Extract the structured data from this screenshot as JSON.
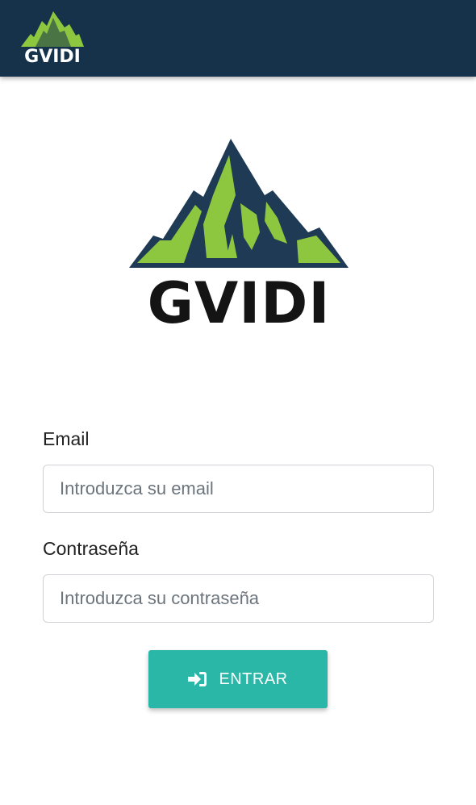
{
  "header": {
    "logo_text": "GVIDI"
  },
  "hero": {
    "logo_text": "GVIDI"
  },
  "login_form": {
    "email_label": "Email",
    "email_placeholder": "Introduzca su email",
    "email_value": "",
    "password_label": "Contraseña",
    "password_placeholder": "Introduzca su contraseña",
    "password_value": "",
    "submit_label": "ENTRAR",
    "submit_icon": "sign-in-icon"
  },
  "colors": {
    "header_bg": "#15324a",
    "brand_green": "#8dc63f",
    "mountain_dark": "#1e3a54",
    "button_teal": "#2bb7a8"
  }
}
